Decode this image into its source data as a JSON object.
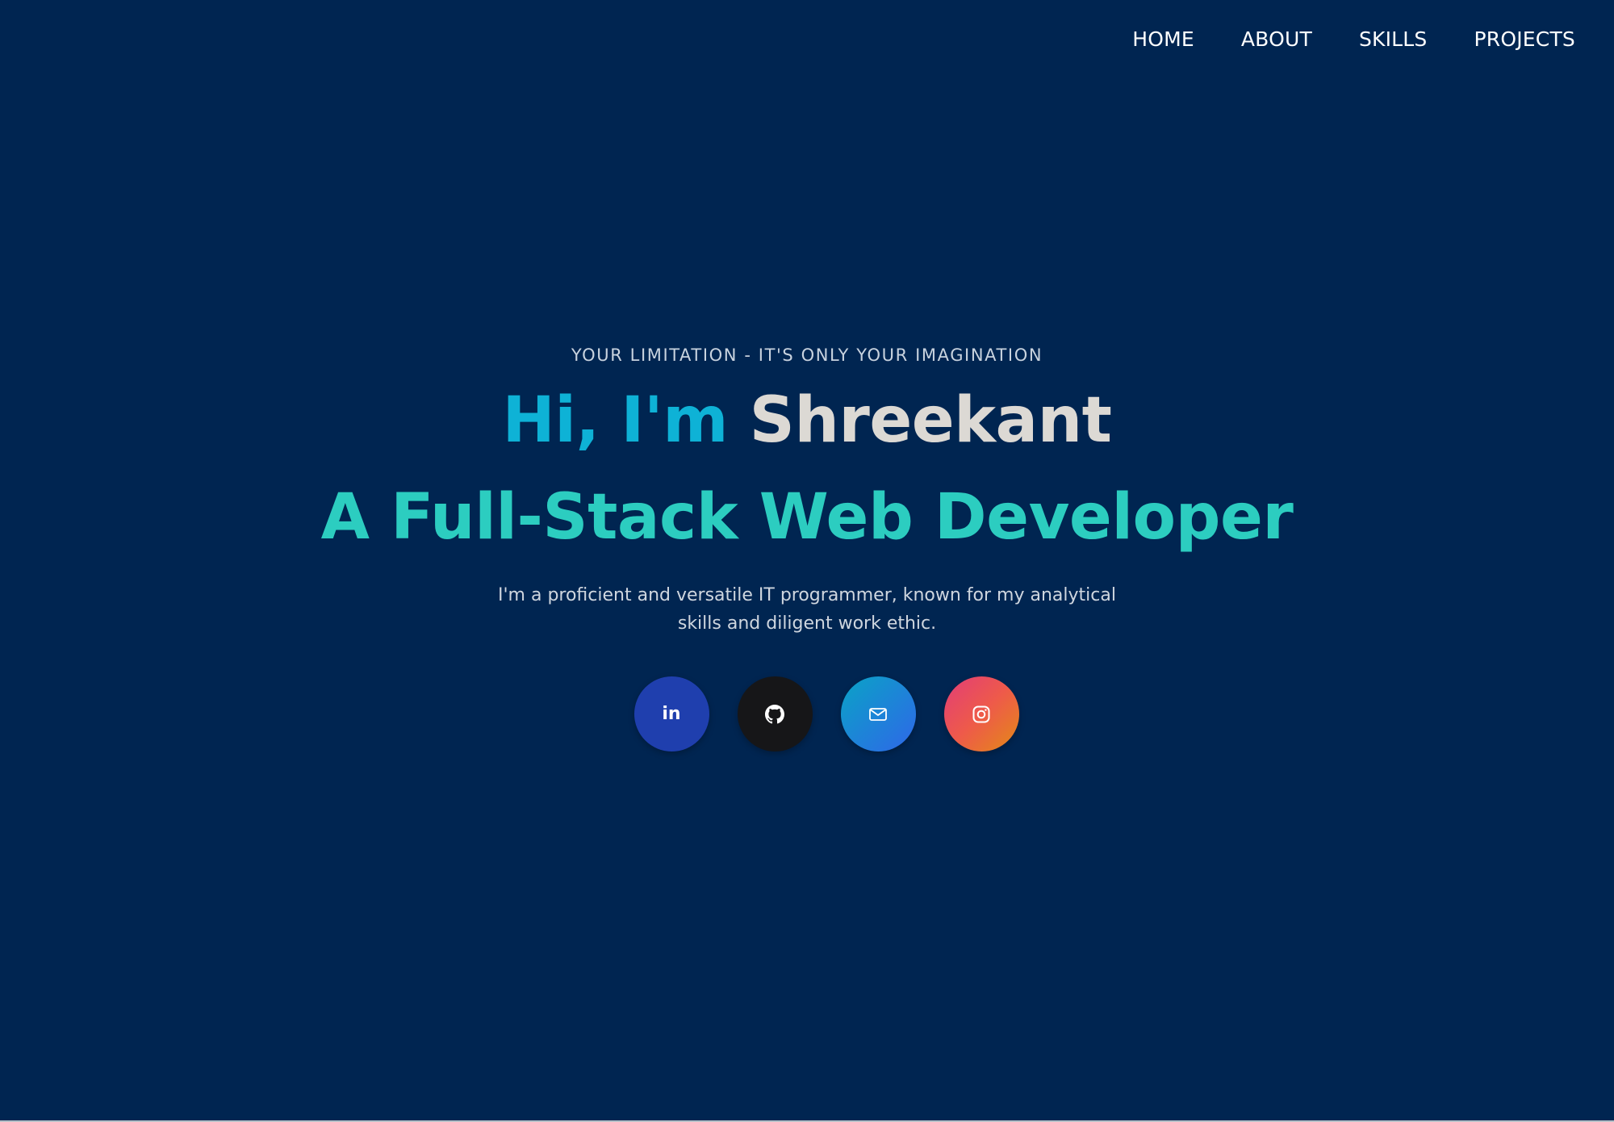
{
  "nav": {
    "items": [
      {
        "label": "HOME"
      },
      {
        "label": "ABOUT"
      },
      {
        "label": "SKILLS"
      },
      {
        "label": "PROJECTS"
      }
    ]
  },
  "hero": {
    "tagline": "YOUR LIMITATION - IT'S ONLY YOUR IMAGINATION",
    "greeting": "Hi, I'm",
    "name": "Shreekant",
    "role": "A Full-Stack Web Developer",
    "bio": "I'm a proficient and versatile IT programmer, known for my analytical skills and diligent work ethic."
  },
  "socials": [
    {
      "icon": "linkedin-icon",
      "glyph": "in",
      "color": "#1f3fae"
    },
    {
      "icon": "github-icon",
      "color": "#161618"
    },
    {
      "icon": "mail-icon",
      "color": "#2f67e8"
    },
    {
      "icon": "instagram-icon",
      "color": "#e23d78"
    }
  ],
  "colors": {
    "background": "#002551",
    "greeting": "#0eb2d6",
    "name": "#dcd9d4",
    "role": "#2ccdc0",
    "nav_text": "#ffffff"
  }
}
